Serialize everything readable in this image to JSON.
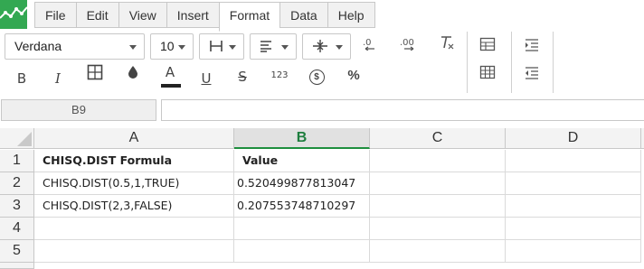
{
  "menu": {
    "items": [
      {
        "label": "File"
      },
      {
        "label": "Edit"
      },
      {
        "label": "View"
      },
      {
        "label": "Insert"
      },
      {
        "label": "Format",
        "active": true
      },
      {
        "label": "Data"
      },
      {
        "label": "Help"
      }
    ]
  },
  "toolbar": {
    "font_name": "Verdana",
    "font_size": "10",
    "bold": "B",
    "italic": "I",
    "font_color_label": "A",
    "underline": "U",
    "strikethrough": "S",
    "number_format": "123",
    "currency": "$",
    "percent": "%"
  },
  "formula_bar": {
    "name_box": "B9",
    "formula": ""
  },
  "sheet": {
    "columns": [
      "A",
      "B",
      "C",
      "D"
    ],
    "selected_column": "B",
    "rows": [
      "1",
      "2",
      "3",
      "4",
      "5"
    ],
    "cells": [
      [
        "CHISQ.DIST Formula",
        "Value",
        "",
        ""
      ],
      [
        "CHISQ.DIST(0.5,1,TRUE)",
        "0.520499877813047",
        "",
        ""
      ],
      [
        "CHISQ.DIST(2,3,FALSE)",
        "0.207553748710297",
        "",
        ""
      ],
      [
        "",
        "",
        "",
        ""
      ],
      [
        "",
        "",
        "",
        ""
      ]
    ]
  },
  "colors": {
    "accent": "#1e8e3e",
    "logo": "#33a852"
  }
}
